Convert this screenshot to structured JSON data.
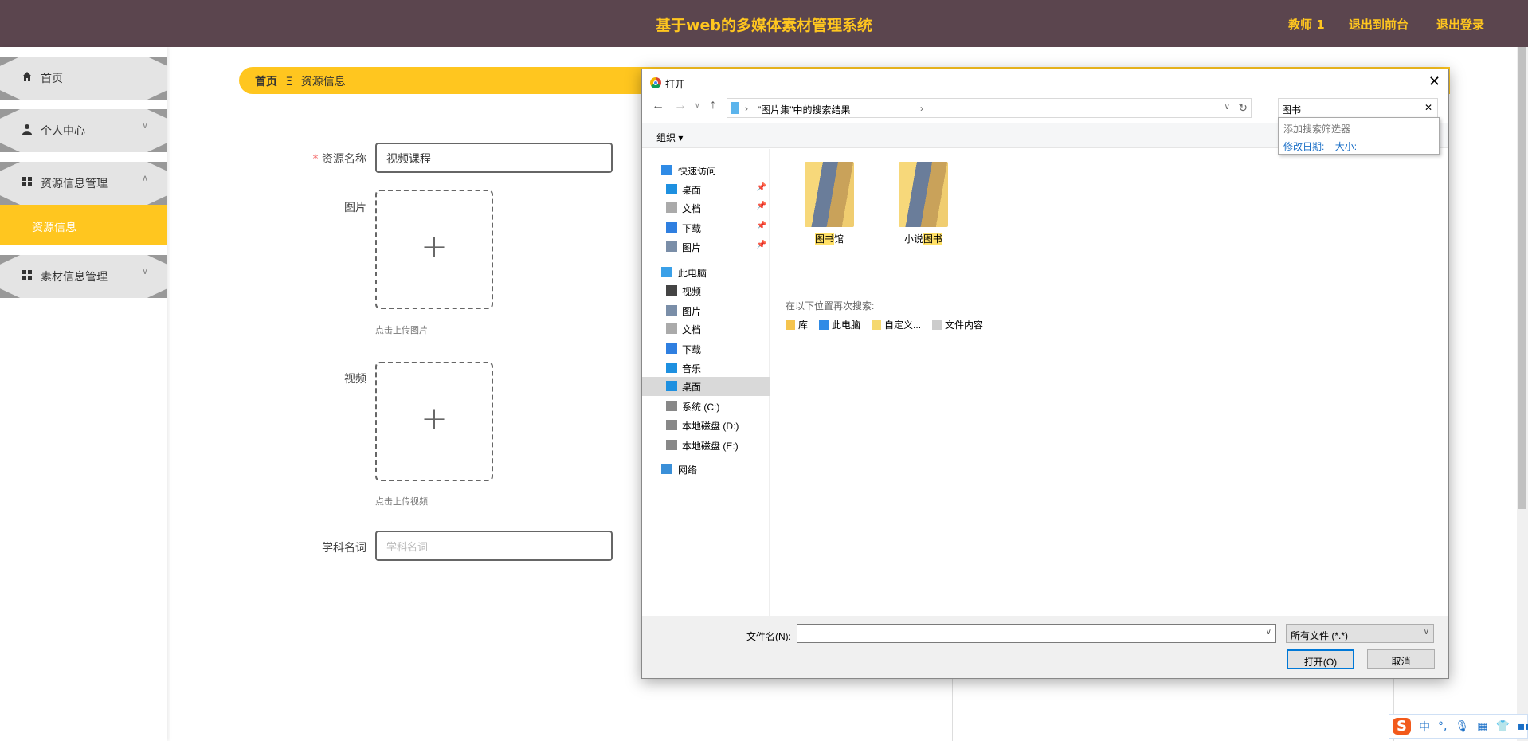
{
  "header": {
    "title": "基于web的多媒体素材管理系统",
    "user": "教师 1",
    "to_front": "退出到前台",
    "logout": "退出登录"
  },
  "sidebar": {
    "items": [
      {
        "label": "首页",
        "icon": "home-icon"
      },
      {
        "label": "个人中心",
        "icon": "user-icon"
      },
      {
        "label": "资源信息管理",
        "icon": "grid-icon"
      },
      {
        "label": "素材信息管理",
        "icon": "grid-icon"
      }
    ],
    "active_sub": "资源信息"
  },
  "breadcrumb": {
    "home": "首页",
    "sep": "Ξ",
    "current": "资源信息"
  },
  "form": {
    "name_label": "资源名称",
    "required": "*",
    "name_value": "视频课程",
    "image_label": "图片",
    "image_hint": "点击上传图片",
    "video_label": "视频",
    "video_hint": "点击上传视频",
    "subject_label": "学科名词",
    "subject_placeholder": "学科名词",
    "plus": "+"
  },
  "dialog": {
    "title": "打开",
    "address": "\"图片集\"中的搜索结果",
    "search_value": "图书",
    "filter_title": "添加搜索筛选器",
    "filter_date": "修改日期:",
    "filter_size": "大小:",
    "organize": "组织 ▾",
    "nav": [
      {
        "label": "快速访问",
        "top": true
      },
      {
        "label": "桌面",
        "pin": true
      },
      {
        "label": "文档",
        "pin": true
      },
      {
        "label": "下载",
        "pin": true
      },
      {
        "label": "图片",
        "pin": true
      },
      {
        "label": "此电脑",
        "top": true
      },
      {
        "label": "视频"
      },
      {
        "label": "图片"
      },
      {
        "label": "文档"
      },
      {
        "label": "下载"
      },
      {
        "label": "音乐"
      },
      {
        "label": "桌面",
        "selected": true
      },
      {
        "label": "系统 (C:)"
      },
      {
        "label": "本地磁盘 (D:)"
      },
      {
        "label": "本地磁盘 (E:)"
      },
      {
        "label": "网络",
        "top": true
      }
    ],
    "folders": [
      {
        "prefix": "",
        "hl": "图书",
        "suffix": "馆"
      },
      {
        "prefix": "小说",
        "hl": "图书",
        "suffix": ""
      }
    ],
    "search_again": "在以下位置再次搜索:",
    "locations": [
      "库",
      "此电脑",
      "自定义...",
      "文件内容"
    ],
    "filename_label": "文件名(N):",
    "filename_value": "",
    "filetype": "所有文件 (*.*)",
    "open": "打开(O)",
    "cancel": "取消"
  },
  "ime": {
    "mode": "中",
    "punct": "°,"
  }
}
